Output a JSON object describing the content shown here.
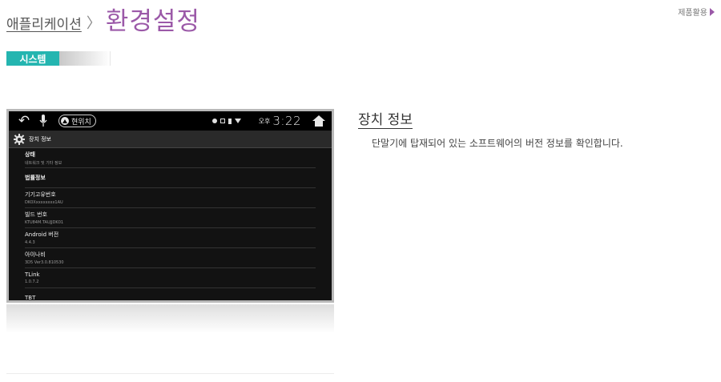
{
  "breadcrumb": {
    "parent": "애플리케이션",
    "separator": "〉",
    "title": "환경설정"
  },
  "header_link": {
    "label": "제품활용"
  },
  "section_tab": {
    "label": "시스템"
  },
  "device": {
    "status_bar": {
      "location_label": "현위치",
      "ampm": "오후",
      "time": "3:22"
    },
    "settings_header": "장치 정보",
    "items": [
      {
        "title": "상태",
        "subtitle": "네트워크 및 기타 정보"
      },
      {
        "title": "법률정보",
        "subtitle": ""
      },
      {
        "title": "기기고유번호",
        "subtitle": "DK0Xxxxxxxxx1AU"
      },
      {
        "title": "빌드 번호",
        "subtitle": "KTU84M.TAUJJDK01"
      },
      {
        "title": "Android 버전",
        "subtitle": "4.4.3"
      },
      {
        "title": "아이나비",
        "subtitle": "3D5 Ver3.0.810530"
      },
      {
        "title": "TLink",
        "subtitle": "1.0.7.2"
      },
      {
        "title": "TBT",
        "subtitle": ""
      }
    ]
  },
  "info": {
    "title": "장치 정보",
    "description": "단말기에 탑재되어 있는 소프트웨어의 버전 정보를 확인합니다."
  },
  "colors": {
    "accent": "#9b59a8",
    "tab": "#24b5b0",
    "screen_bg": "#121212"
  }
}
